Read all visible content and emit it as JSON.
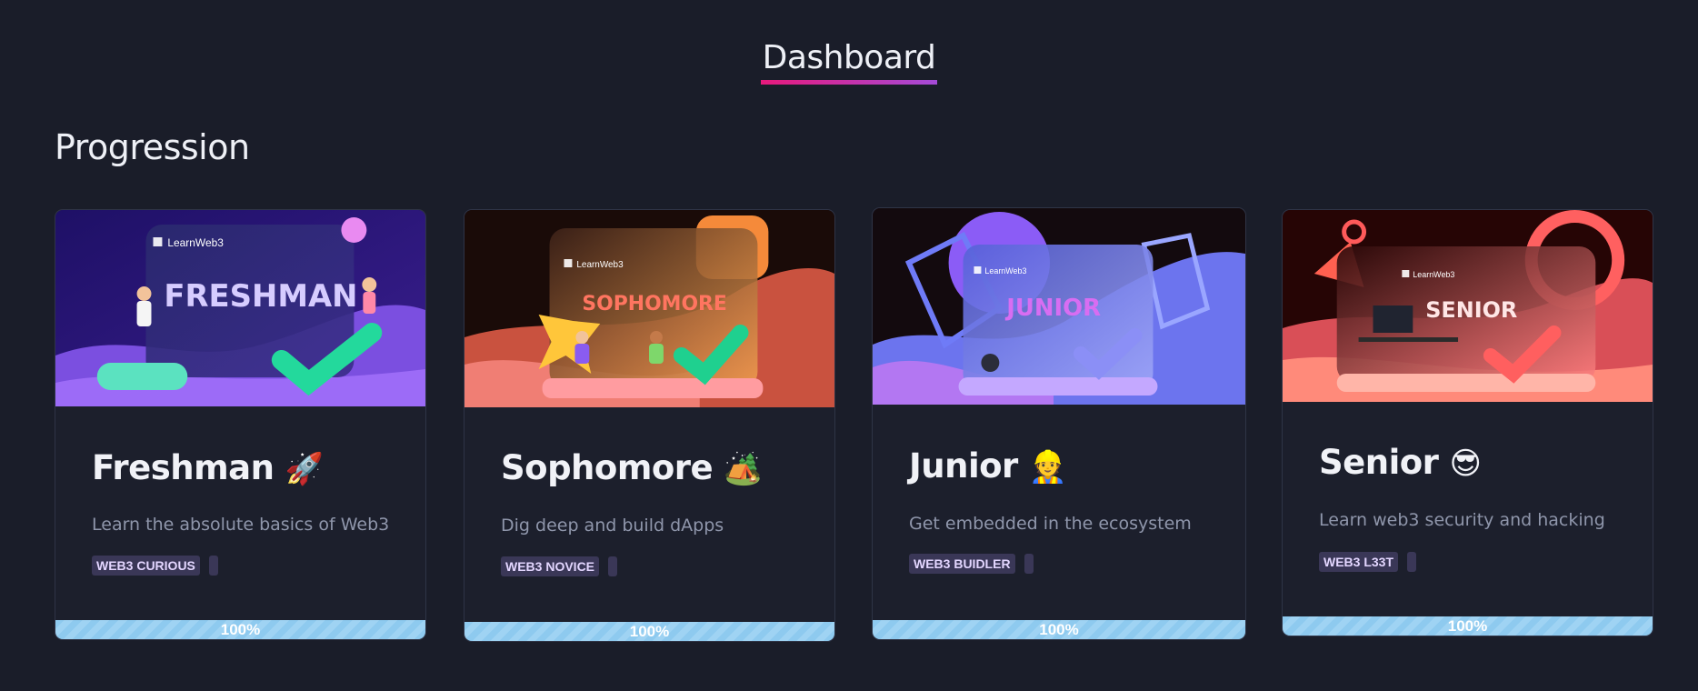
{
  "page": {
    "title": "Dashboard",
    "section_title": "Progression"
  },
  "cards": [
    {
      "name": "Freshman",
      "emoji": "🚀",
      "description": "Learn the absolute basics of Web3",
      "badge": "WEB3 CURIOUS",
      "hero_brand": "LearnWeb3",
      "hero_word": "FRESHMAN",
      "progress_percent": 100,
      "progress_label": "100%",
      "colors": {
        "bg": "#2a1a6e",
        "accent": "#9b6bff",
        "word": "#d6ccff"
      }
    },
    {
      "name": "Sophomore",
      "emoji": "🏕️",
      "description": "Dig deep and build dApps",
      "badge": "WEB3 NOVICE",
      "hero_brand": "LearnWeb3",
      "hero_word": "SOPHOMORE",
      "progress_percent": 100,
      "progress_label": "100%",
      "colors": {
        "bg": "#1c0d0a",
        "accent": "#e4614c",
        "word": "#ff7560"
      }
    },
    {
      "name": "Junior",
      "emoji": "👷",
      "description": "Get embedded in the ecosystem",
      "badge": "WEB3 BUIDLER",
      "hero_brand": "LearnWeb3",
      "hero_word": "JUNIOR",
      "progress_percent": 100,
      "progress_label": "100%",
      "colors": {
        "bg": "#140b10",
        "accent": "#6b6cf0",
        "word": "#d86df2"
      }
    },
    {
      "name": "Senior",
      "emoji": "😎",
      "description": "Learn web3 security and hacking",
      "badge": "WEB3 L33T",
      "hero_brand": "LearnWeb3",
      "hero_word": "SENIOR",
      "progress_percent": 100,
      "progress_label": "100%",
      "colors": {
        "bg": "#2a0606",
        "accent": "#f45a5a",
        "word": "#ffe6e6"
      }
    }
  ]
}
